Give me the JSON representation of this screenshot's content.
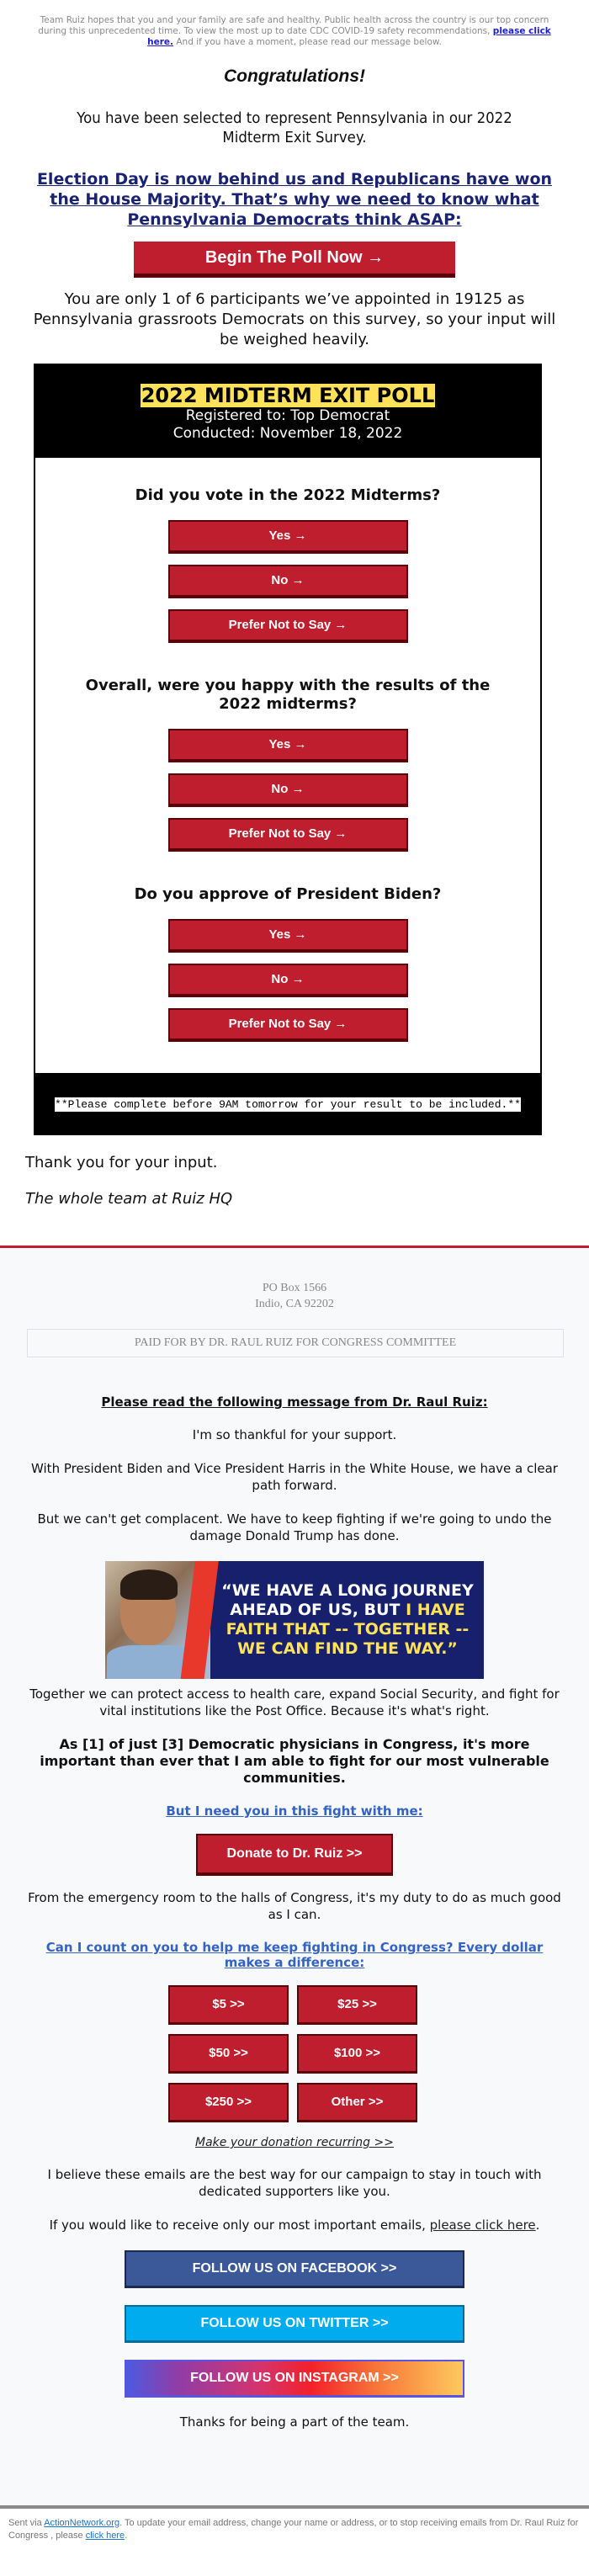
{
  "preheader": {
    "text_before": "Team Ruiz hopes that you and your family are safe and healthy. Public health across the country is our top concern during this unprecedented time. To view the most up to date CDC COVID-19 safety recommendations, ",
    "link": "please click here.",
    "text_after": " And if you have a moment, please read our message below."
  },
  "intro": {
    "congrats": "Congratulations!",
    "selected": "You have been selected to represent Pennsylvania in our 2022 Midterm Exit Survey.",
    "headline": "Election Day is now behind us and Republicans have won the House Majority. That’s why we need to know what Pennsylvania Democrats think ASAP:",
    "begin_button": "Begin The Poll Now →",
    "participants": "You are only 1 of 6 participants we’ve appointed in 19125 as Pennsylvania grassroots Democrats on this survey, so your input will be weighed heavily."
  },
  "poll": {
    "title": "2022 MIDTERM EXIT POLL",
    "registered": "Registered to: Top Democrat",
    "conducted": "Conducted: November 18, 2022",
    "questions": [
      {
        "text": "Did you vote in the 2022 Midterms?",
        "answers": [
          "Yes →",
          "No →",
          "Prefer Not to Say →"
        ]
      },
      {
        "text": "Overall, were you happy with the results of the 2022 midterms?",
        "answers": [
          "Yes →",
          "No →",
          "Prefer Not to Say →"
        ]
      },
      {
        "text": "Do you approve of President Biden?",
        "answers": [
          "Yes →",
          "No →",
          "Prefer Not to Say →"
        ]
      }
    ],
    "deadline": "**Please complete before 9AM tomorrow for your result to be included.**"
  },
  "closing": {
    "thanks": "Thank you for your input.",
    "signature": "The whole team at Ruiz HQ"
  },
  "lower": {
    "address_line1": "PO Box 1566",
    "address_line2": "Indio, CA 92202",
    "paid_for": "PAID FOR BY DR. RAUL RUIZ FOR CONGRESS COMMITTEE",
    "message_heading": "Please read the following message from Dr. Raul Ruiz:",
    "p1": "I'm so thankful for your support.",
    "p2": "With President Biden and Vice President Harris in the White House, we have a clear path forward.",
    "p3": "But we can't get complacent. We have to keep fighting if we're going to undo the damage Donald Trump has done.",
    "banner": {
      "quote_white": "“WE HAVE A LONG JOURNEY AHEAD OF US, BUT ",
      "quote_yellow": "I HAVE FAITH THAT -- TOGETHER -- WE CAN FIND THE WAY.”"
    },
    "p4": "Together we can protect access to health care, expand Social Security, and fight for vital institutions like the Post Office. Because it's what's right.",
    "p5": "As [1] of just [3] Democratic physicians in Congress, it's more important than ever that I am able to fight for our most vulnerable communities.",
    "need_you_link": "But I need you in this fight with me:",
    "donate_button": "Donate to Dr. Ruiz >>",
    "p6": "From the emergency room to the halls of Congress, it's my duty to do as much good as I can.",
    "count_on_link": "Can I count on you to help me keep fighting in Congress? Every dollar makes a difference:",
    "amounts": [
      "$5 >>",
      "$25 >>",
      "$50 >>",
      "$100 >>",
      "$250 >>",
      "Other >>"
    ],
    "recurring_link": "Make your donation recurring >>",
    "p7": "I believe these emails are the best way for our campaign to stay in touch with dedicated supporters like you.",
    "p8_before": "If you would like to receive only our most important emails, ",
    "p8_link": "please click here",
    "p8_after": ".",
    "facebook": "FOLLOW US ON FACEBOOK >>",
    "twitter": "FOLLOW US ON TWITTER >>",
    "instagram": "FOLLOW US ON INSTAGRAM >>",
    "team_thanks": "Thanks for being a part of the team."
  },
  "footer": {
    "sent_via": "Sent via ",
    "network_link": "ActionNetwork.org",
    "text": ". To update your email address, change your name or address, or to stop receiving emails from Dr. Raul Ruiz for Congress , please ",
    "click_link": "click here",
    "end": "."
  },
  "colors": {
    "button_red": "#bf1e2e",
    "button_shadow": "#5a0008",
    "headline_navy": "#1a2372",
    "poll_highlight": "#ffe15a",
    "facebook": "#3b5998",
    "twitter": "#00acee",
    "link_blue": "#3463c4"
  }
}
